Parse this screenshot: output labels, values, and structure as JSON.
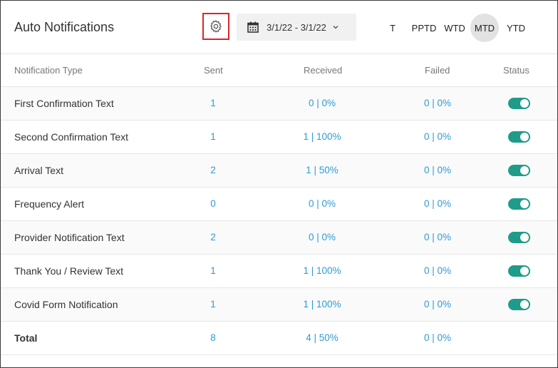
{
  "header": {
    "title": "Auto Notifications",
    "date_range": "3/1/22 - 3/1/22",
    "periods": [
      {
        "label": "T",
        "active": false
      },
      {
        "label": "PPTD",
        "active": false
      },
      {
        "label": "WTD",
        "active": false
      },
      {
        "label": "MTD",
        "active": true
      },
      {
        "label": "YTD",
        "active": false
      }
    ]
  },
  "table": {
    "columns": [
      "Notification Type",
      "Sent",
      "Received",
      "Failed",
      "Status"
    ],
    "rows": [
      {
        "name": "First Confirmation Text",
        "sent": "1",
        "received": "0 | 0%",
        "failed": "0 | 0%",
        "status": true
      },
      {
        "name": "Second Confirmation Text",
        "sent": "1",
        "received": "1 | 100%",
        "failed": "0 | 0%",
        "status": true
      },
      {
        "name": "Arrival Text",
        "sent": "2",
        "received": "1 | 50%",
        "failed": "0 | 0%",
        "status": true
      },
      {
        "name": "Frequency Alert",
        "sent": "0",
        "received": "0 | 0%",
        "failed": "0 | 0%",
        "status": true
      },
      {
        "name": "Provider Notification Text",
        "sent": "2",
        "received": "0 | 0%",
        "failed": "0 | 0%",
        "status": true
      },
      {
        "name": "Thank You / Review Text",
        "sent": "1",
        "received": "1 | 100%",
        "failed": "0 | 0%",
        "status": true
      },
      {
        "name": "Covid Form Notification",
        "sent": "1",
        "received": "1 | 100%",
        "failed": "0 | 0%",
        "status": true
      }
    ],
    "total": {
      "name": "Total",
      "sent": "8",
      "received": "4 | 50%",
      "failed": "0 | 0%"
    }
  },
  "colors": {
    "link": "#2c9bd6",
    "toggle_on": "#1f9b89",
    "highlight_border": "#d9262a"
  },
  "icons": {
    "settings": "gear-icon",
    "calendar": "calendar-icon",
    "dropdown": "chevron-down-icon"
  }
}
